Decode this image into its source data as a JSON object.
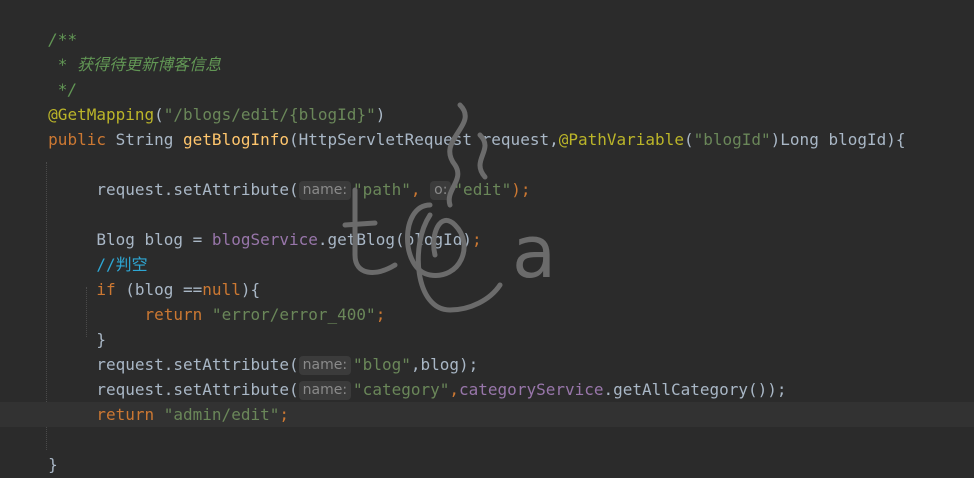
{
  "code": {
    "l1": "/**",
    "l2": " * 获得待更新博客信息",
    "l3": " */",
    "l4_ann": "@GetMapping",
    "l4_open": "(",
    "l4_str": "\"/blogs/edit/{blogId}\"",
    "l4_close": ")",
    "l5_public": "public",
    "l5_type": " String ",
    "l5_method": "getBlogInfo",
    "l5_params_a": "(HttpServletRequest request,",
    "l5_ann": "@PathVariable",
    "l5_paren": "(",
    "l5_str": "\"blogId\"",
    "l5_params_b": ")Long blogId){",
    "l7_call": "request.setAttribute(",
    "l7_hint1": "name:",
    "l7_str1": "\"path\"",
    "l7_comma": ",",
    "l7_hint2": "o:",
    "l7_str2": "\"edit\"",
    "l7_end": ");",
    "l9_a": "Blog blog = ",
    "l9_field": "blogService",
    "l9_b": ".getBlog(blogId)",
    "l9_semi": ";",
    "l10_comment": "//判空",
    "l11_if": "if",
    "l11_a": " (blog ==",
    "l11_null": "null",
    "l11_b": "){",
    "l12_return": "return",
    "l12_str": " \"error/error_400\"",
    "l12_semi": ";",
    "l13": "}",
    "l14_call": "request.setAttribute(",
    "l14_hint": "name:",
    "l14_str": "\"blog\"",
    "l14_end": ",blog);",
    "l15_call": "request.setAttribute(",
    "l15_hint": "name:",
    "l15_str": "\"category\"",
    "l15_comma": ",",
    "l15_field": "categoryService",
    "l15_end": ".getAllCategory());",
    "l16_return": "return",
    "l16_str": " \"admin/edit\"",
    "l16_semi": ";",
    "l18": "}"
  },
  "colors": {
    "background": "#2b2b2b",
    "doc_comment": "#629755",
    "annotation": "#bbb529",
    "string": "#6a8759",
    "keyword": "#cc7832",
    "text": "#a9b7c6",
    "method": "#ffc66d",
    "field": "#9876aa",
    "line_comment": "#2ea7d4"
  },
  "watermark": {
    "icon": "tea-cup-watermark",
    "letter": "a"
  }
}
